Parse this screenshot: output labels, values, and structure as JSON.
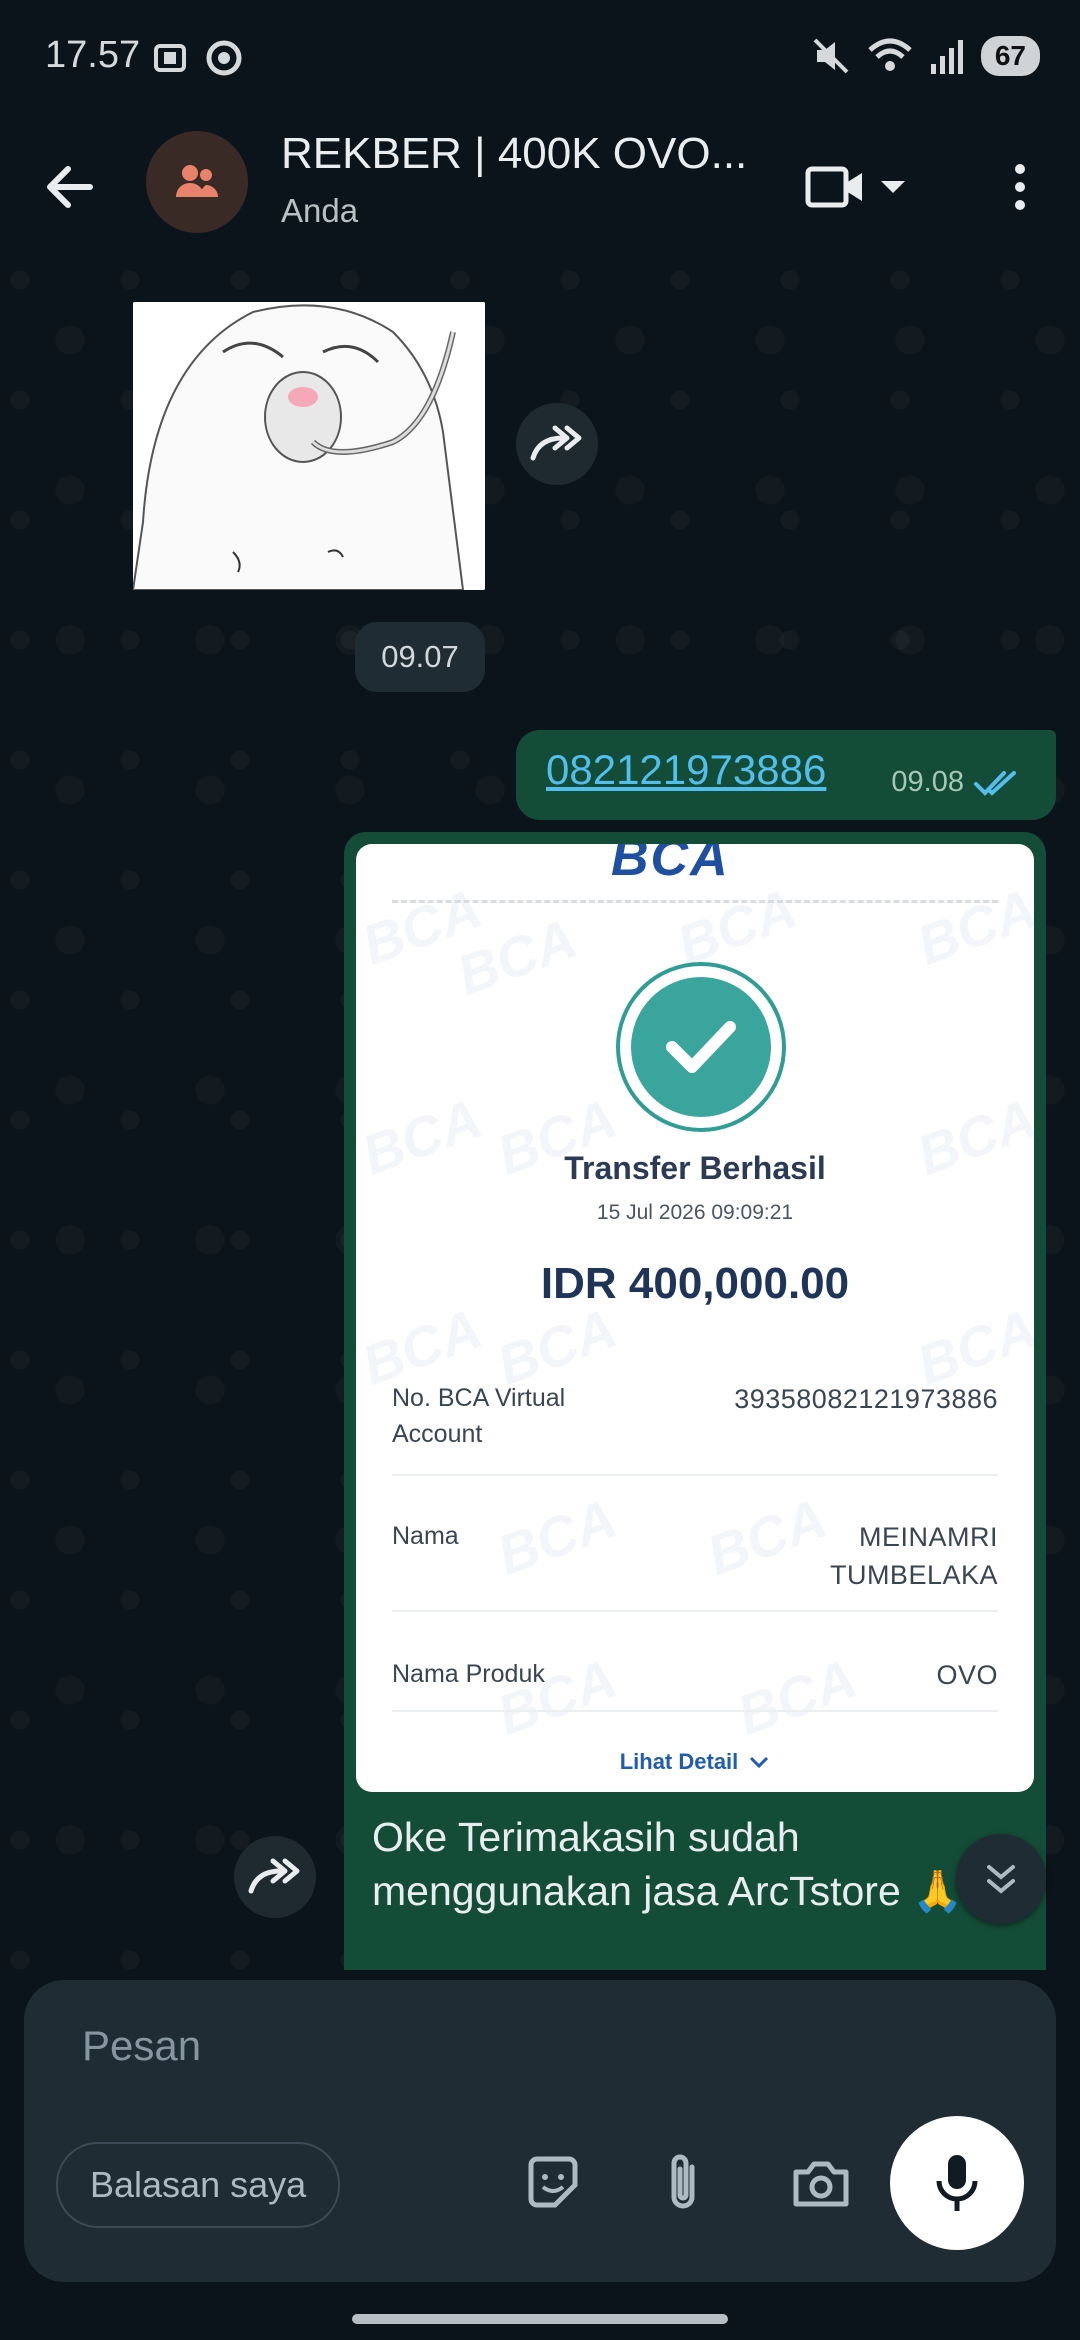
{
  "status_bar": {
    "time": "17.57",
    "battery": "67"
  },
  "header": {
    "title": "REKBER | 400K OVO...",
    "subtitle": "Anda"
  },
  "messages": {
    "time_chip": "09.07",
    "phone_message": {
      "text": "082121973886",
      "time": "09.08"
    },
    "receipt": {
      "bank_logo": "BCA",
      "title": "Transfer Berhasil",
      "datetime": "15 Jul 2026 09:09:21",
      "amount": "IDR 400,000.00",
      "rows": [
        {
          "label": "No. BCA Virtual Account",
          "value": "39358082121973886"
        },
        {
          "label": "Nama",
          "value": "MEINAMRI TUMBELAKA"
        },
        {
          "label": "Nama Produk",
          "value": "OVO"
        }
      ],
      "detail_link": "Lihat Detail",
      "watermark": "BCA"
    },
    "caption": "Oke Terimakasih sudah menggunakan jasa ArcTstore 🙏."
  },
  "composer": {
    "placeholder": "Pesan",
    "quick_reply": "Balasan saya"
  },
  "icons": {
    "back": "arrow-left-icon",
    "group": "group-avatar-icon",
    "video": "video-call-icon",
    "more": "more-vertical-icon",
    "forward": "forward-icon",
    "read": "double-check-icon",
    "sticker": "sticker-icon",
    "attach": "paperclip-icon",
    "camera": "camera-icon",
    "mic": "mic-icon"
  },
  "colors": {
    "background": "#0b141a",
    "outgoing_bubble": "#144d37",
    "link": "#53bdeb",
    "receipt_check": "#3aa59d"
  }
}
